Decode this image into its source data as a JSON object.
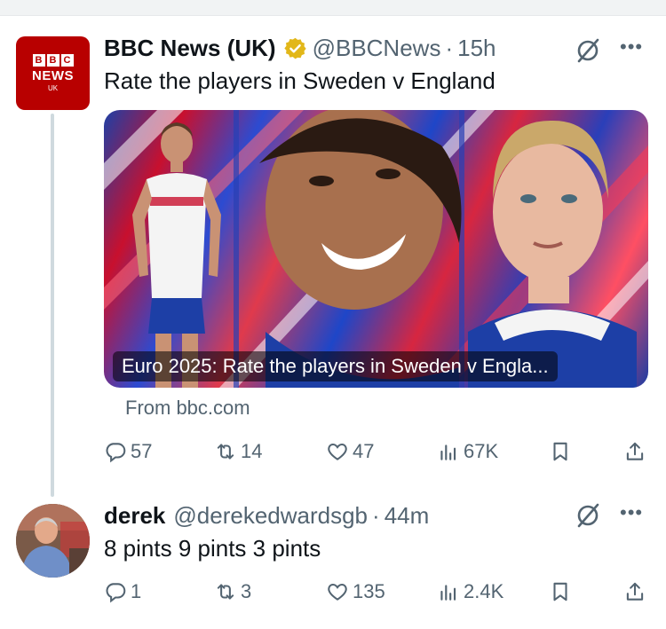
{
  "tweet1": {
    "author_name": "BBC News (UK)",
    "handle": "@BBCNews",
    "separator": "·",
    "time": "15h",
    "avatar": {
      "brand_blocks": [
        "B",
        "B",
        "C"
      ],
      "brand_word": "NEWS",
      "region": "UK"
    },
    "text": "Rate the players in Sweden v England",
    "card": {
      "caption": "Euro 2025: Rate the players in Sweden v Engla...",
      "source": "From bbc.com"
    },
    "actions": {
      "replies": "57",
      "reposts": "14",
      "likes": "47",
      "views": "67K"
    }
  },
  "tweet2": {
    "author_name": "derek",
    "handle": "@derekedwardsgb",
    "separator": "·",
    "time": "44m",
    "text": "8 pints 9 pints 3 pints",
    "actions": {
      "replies": "1",
      "reposts": "3",
      "likes": "135",
      "views": "2.4K"
    }
  },
  "colors": {
    "bbc_red": "#b80000",
    "verified_gold": "#e2b719",
    "muted": "#536471",
    "text": "#0f1419"
  },
  "icons": [
    "verified-badge-icon",
    "grok-icon",
    "more-icon",
    "reply-icon",
    "repost-icon",
    "like-icon",
    "views-icon",
    "bookmark-icon",
    "share-icon"
  ]
}
